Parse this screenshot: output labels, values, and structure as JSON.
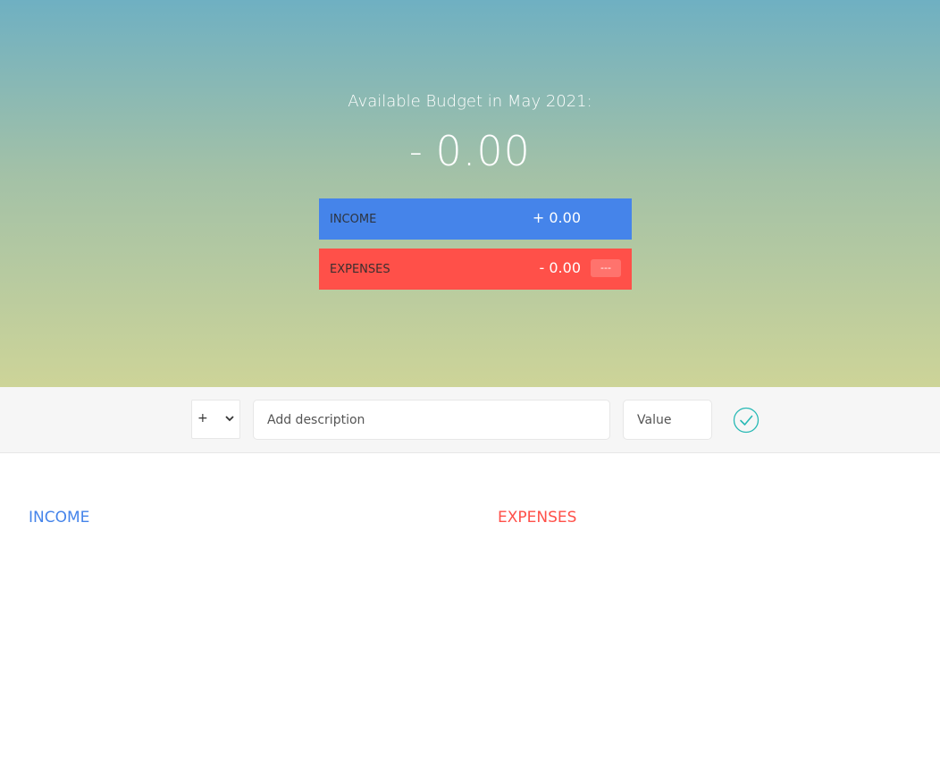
{
  "header": {
    "budget_title": "Available Budget in May 2021:",
    "budget_sign": "-",
    "budget_amount": "0.00",
    "income_label": "INCOME",
    "income_value": "+ 0.00",
    "expenses_label": "EXPENSES",
    "expenses_value": "- 0.00",
    "expenses_percentage": "---"
  },
  "add_form": {
    "type_selected": "+",
    "description_placeholder": "Add description",
    "value_placeholder": "Value",
    "submit_icon": "checkmark-circle-icon"
  },
  "lists": {
    "income_title": "INCOME",
    "expenses_title": "EXPENSES"
  },
  "colors": {
    "income": "#4584ea",
    "expenses": "#ff5049",
    "accent": "#28b9b5"
  }
}
